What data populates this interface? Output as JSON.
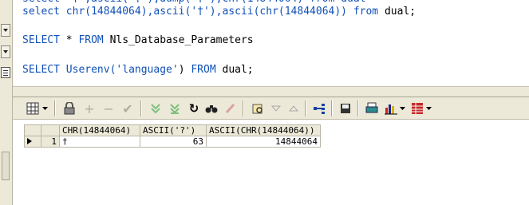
{
  "editor": {
    "line1": {
      "kw1": "select",
      "mid1": " chr(14844064),ascii('†'),ascii(chr(14844064)) ",
      "kw2": "from",
      "tail": " dual;"
    },
    "line2": {
      "kw1": "SELECT",
      "mid": " * ",
      "kw2": "FROM",
      "tail": " Nls_Database_Parameters"
    },
    "line3": {
      "kw1": "SELECT",
      "fn": " Userenv(",
      "str": "'language'",
      "close": ") ",
      "kw2": "FROM",
      "tail": " dual;"
    }
  },
  "toolbar": {
    "icons": [
      "grid-view-icon",
      "lock-icon",
      "add-record-icon",
      "delete-record-icon",
      "post-changes-icon",
      "fetch-next-icon",
      "fetch-last-icon",
      "refresh-icon",
      "find-icon",
      "clear-icon",
      "query-by-example-icon",
      "previous-record-icon",
      "next-record-icon",
      "export-icon",
      "save-icon",
      "print-icon",
      "chart-icon",
      "table-options-icon"
    ]
  },
  "grid": {
    "columns": [
      "CHR(14844064)",
      "ASCII('?')",
      "ASCII(CHR(14844064))"
    ],
    "rows": [
      {
        "num": "1",
        "c1": "†",
        "c2": "63",
        "c3": "14844064"
      }
    ]
  }
}
